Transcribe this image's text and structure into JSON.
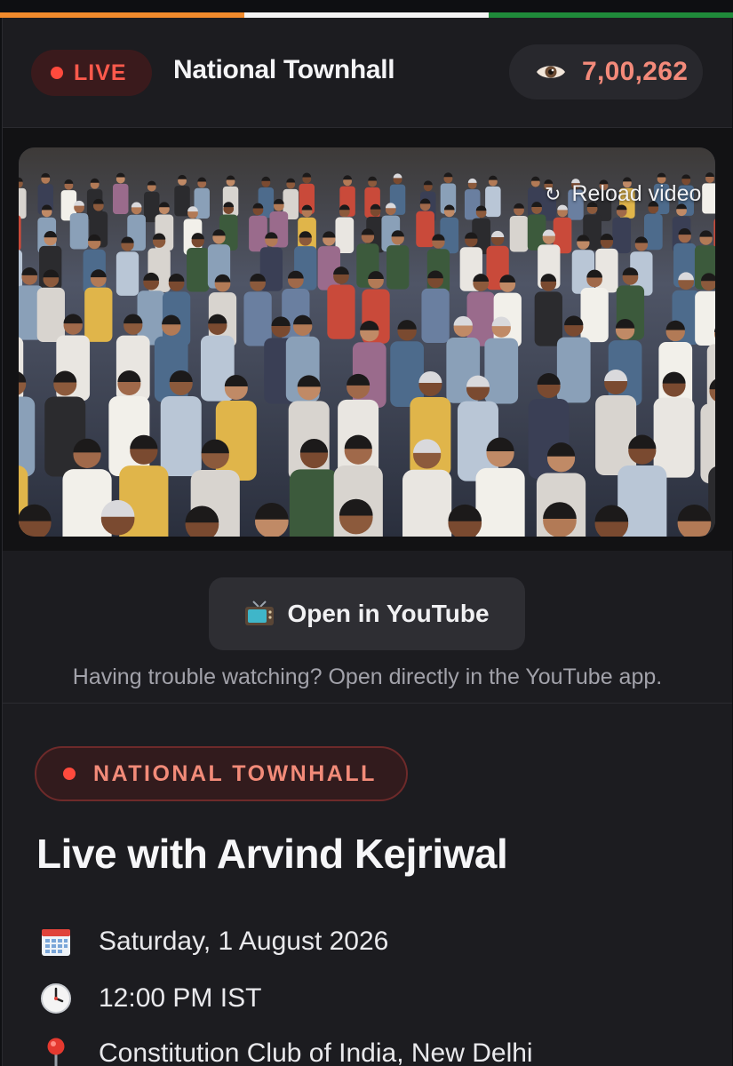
{
  "colors": {
    "saffron": "#f08a2c",
    "white": "#f3f3f3",
    "green": "#1f8a3a",
    "live_red": "#ff4a3d",
    "accent_salmon": "#f38a7a"
  },
  "header": {
    "live_label": "LIVE",
    "title": "National Townhall",
    "viewer_icon": "eye-icon",
    "viewer_count": "7,00,262"
  },
  "video": {
    "reload_icon": "reload-icon",
    "reload_label": "Reload video"
  },
  "youtube": {
    "button_icon": "tv-icon",
    "button_label": "Open in YouTube",
    "help_text": "Having trouble watching? Open directly in the YouTube app."
  },
  "event": {
    "tag_label": "NATIONAL TOWNHALL",
    "title": "Live with Arvind Kejriwal",
    "date_icon": "calendar-icon",
    "date": "Saturday, 1 August 2026",
    "time_icon": "clock-icon",
    "time": "12:00 PM IST",
    "location_icon": "location-pin-icon",
    "location": "Constitution Club of India, New Delhi"
  }
}
